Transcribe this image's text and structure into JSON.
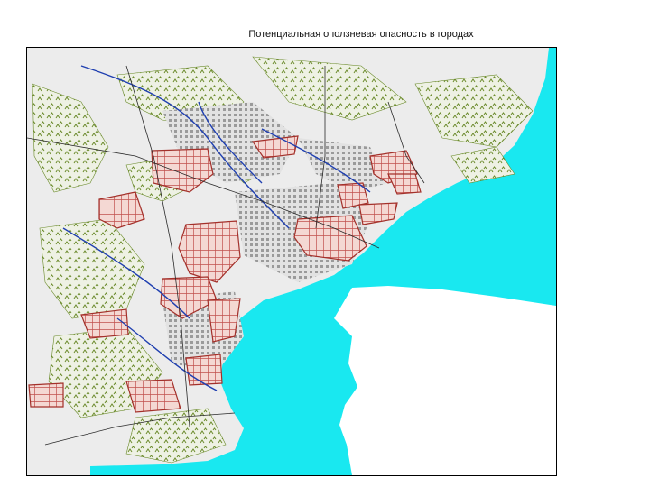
{
  "slide": {
    "title": "Потенциальная оползневая опасность в городах"
  },
  "map": {
    "colors": {
      "land": "#ececec",
      "sea": "#19e8f0",
      "vegetation": "#6a8a2a",
      "hazard_outline": "#a3302a",
      "hazard_hatch": "#c0504d",
      "urban_block": "#9a9a9a",
      "river": "#1f3fb0",
      "road": "#2a2a2a"
    }
  }
}
